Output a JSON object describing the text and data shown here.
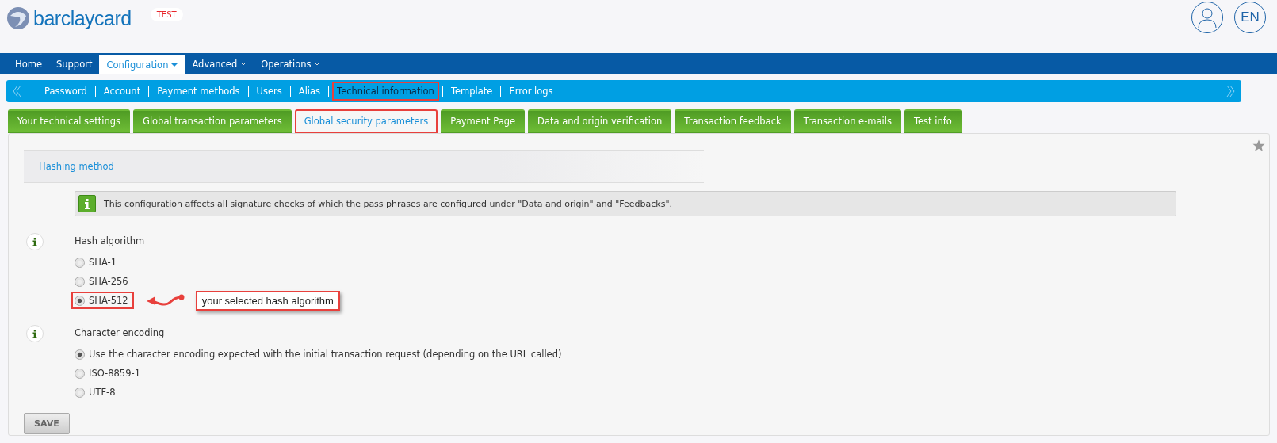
{
  "header": {
    "brand": "barclaycard",
    "env_badge": "TEST",
    "language": "EN"
  },
  "main_nav": [
    {
      "label": "Home",
      "selected": false,
      "dropdown": false
    },
    {
      "label": "Support",
      "selected": false,
      "dropdown": false
    },
    {
      "label": "Configuration",
      "selected": true,
      "dropdown": true
    },
    {
      "label": "Advanced",
      "selected": false,
      "dropdown": true
    },
    {
      "label": "Operations",
      "selected": false,
      "dropdown": true
    }
  ],
  "sub_nav": [
    {
      "label": "Password",
      "highlighted": false
    },
    {
      "label": "Account",
      "highlighted": false
    },
    {
      "label": "Payment methods",
      "highlighted": false
    },
    {
      "label": "Users",
      "highlighted": false
    },
    {
      "label": "Alias",
      "highlighted": false
    },
    {
      "label": "Technical information",
      "highlighted": true
    },
    {
      "label": "Template",
      "highlighted": false
    },
    {
      "label": "Error logs",
      "highlighted": false
    }
  ],
  "tabs": [
    {
      "label": "Your technical settings",
      "selected": false,
      "highlighted": false
    },
    {
      "label": "Global transaction parameters",
      "selected": false,
      "highlighted": false
    },
    {
      "label": "Global security parameters",
      "selected": true,
      "highlighted": true
    },
    {
      "label": "Payment Page",
      "selected": false,
      "highlighted": false
    },
    {
      "label": "Data and origin verification",
      "selected": false,
      "highlighted": false
    },
    {
      "label": "Transaction feedback",
      "selected": false,
      "highlighted": false
    },
    {
      "label": "Transaction e-mails",
      "selected": false,
      "highlighted": false
    },
    {
      "label": "Test info",
      "selected": false,
      "highlighted": false
    }
  ],
  "section_title": "Hashing method",
  "notice": "This configuration affects all signature checks of which the pass phrases are configured under \"Data and origin\" and \"Feedbacks\".",
  "groups": [
    {
      "label": "Hash algorithm",
      "options": [
        {
          "label": "SHA-1",
          "selected": false,
          "highlighted": false
        },
        {
          "label": "SHA-256",
          "selected": false,
          "highlighted": false
        },
        {
          "label": "SHA-512",
          "selected": true,
          "highlighted": true,
          "callout": "your selected hash algorithm"
        }
      ]
    },
    {
      "label": "Character encoding",
      "options": [
        {
          "label": "Use the character encoding expected with the initial transaction request (depending on the URL called)",
          "selected": true,
          "highlighted": false
        },
        {
          "label": "ISO-8859-1",
          "selected": false,
          "highlighted": false
        },
        {
          "label": "UTF-8",
          "selected": false,
          "highlighted": false
        }
      ]
    }
  ],
  "save_button": "SAVE"
}
